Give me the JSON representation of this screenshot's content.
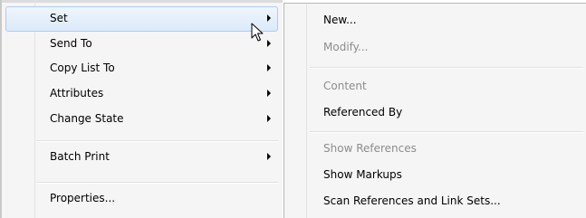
{
  "context_menu": {
    "items": [
      {
        "label": "Set",
        "has_submenu": true,
        "highlighted": true
      },
      {
        "label": "Send To",
        "has_submenu": true
      },
      {
        "label": "Copy List To",
        "has_submenu": true
      },
      {
        "label": "Attributes",
        "has_submenu": true
      },
      {
        "label": "Change State",
        "has_submenu": true
      },
      {
        "label": "Batch Print",
        "has_submenu": true
      },
      {
        "label": "Properties...",
        "has_submenu": false
      }
    ]
  },
  "submenu": {
    "items": [
      {
        "label": "New...",
        "enabled": true
      },
      {
        "label": "Modify...",
        "enabled": false
      },
      {
        "label": "Content",
        "enabled": false
      },
      {
        "label": "Referenced By",
        "enabled": true
      },
      {
        "label": "Show References",
        "enabled": false
      },
      {
        "label": "Show Markups",
        "enabled": true
      },
      {
        "label": "Scan References and Link Sets...",
        "enabled": true
      }
    ]
  },
  "colors": {
    "highlight_border": "#aecbf0",
    "highlight_fill": "#dceaf9",
    "disabled_text": "#8d8d8d",
    "menu_background": "#f5f5f5"
  },
  "cursor": {
    "icon": "arrow-pointer-icon"
  }
}
